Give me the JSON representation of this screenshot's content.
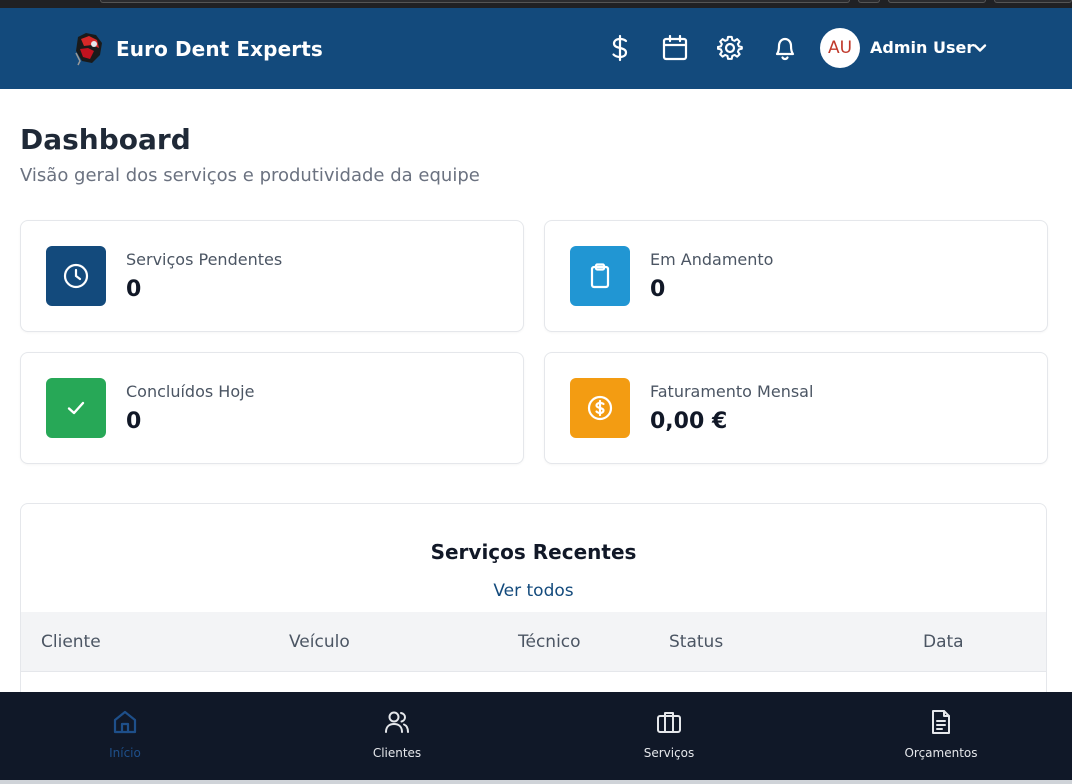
{
  "header": {
    "brand": "Euro Dent Experts",
    "icons": [
      "dollar-icon",
      "calendar-icon",
      "gear-icon",
      "bell-icon"
    ],
    "user": {
      "initials": "AU",
      "name": "Admin User"
    }
  },
  "page": {
    "title": "Dashboard",
    "subtitle": "Visão geral dos serviços e produtividade da equipe"
  },
  "stats": [
    {
      "label": "Serviços Pendentes",
      "value": "0",
      "color": "#134a7c",
      "icon": "clock-icon"
    },
    {
      "label": "Em Andamento",
      "value": "0",
      "color": "#2196d3",
      "icon": "clipboard-icon"
    },
    {
      "label": "Concluídos Hoje",
      "value": "0",
      "color": "#27a857",
      "icon": "check-icon"
    },
    {
      "label": "Faturamento Mensal",
      "value": "0,00 €",
      "color": "#f39c12",
      "icon": "euro-coin-icon"
    }
  ],
  "recent": {
    "title": "Serviços Recentes",
    "link": "Ver todos",
    "columns": [
      "Cliente",
      "Veículo",
      "Técnico",
      "Status",
      "Data"
    ]
  },
  "nav": {
    "items": [
      {
        "label": "Início",
        "icon": "home-icon",
        "active": true
      },
      {
        "label": "Clientes",
        "icon": "users-icon",
        "active": false
      },
      {
        "label": "Serviços",
        "icon": "briefcase-icon",
        "active": false
      },
      {
        "label": "Orçamentos",
        "icon": "document-icon",
        "active": false
      }
    ]
  },
  "colors": {
    "header": "#134a7c",
    "bottom_nav": "#101828",
    "active_nav": "#1e4f8a"
  }
}
